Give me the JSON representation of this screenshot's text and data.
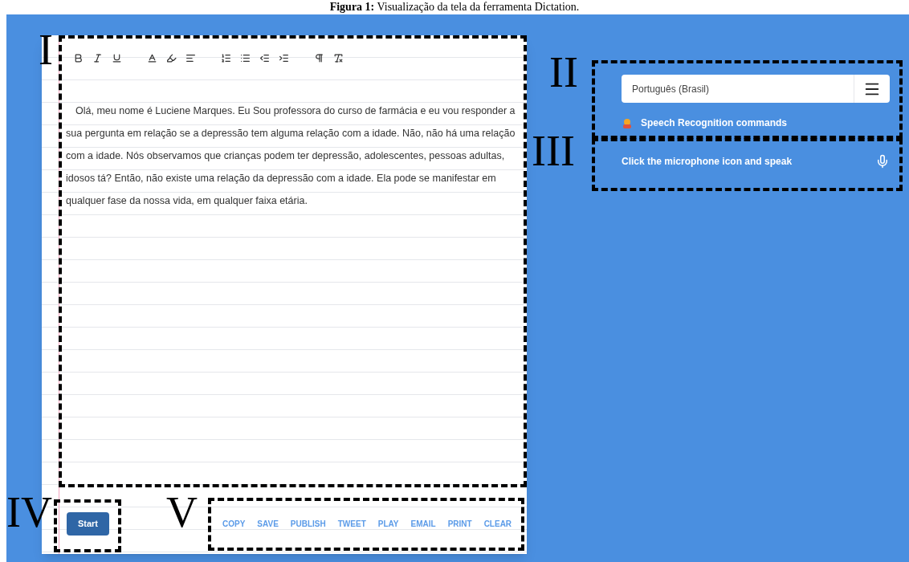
{
  "caption": "**Figura 1:** Visualização da tela da ferramenta Dictation.",
  "annotations": [
    {
      "label": "I"
    },
    {
      "label": "II"
    },
    {
      "label": "III"
    },
    {
      "label": "IV"
    },
    {
      "label": "V"
    }
  ],
  "editor": {
    "text": "Olá, meu nome é Luciene Marques. Eu Sou professora do curso de farmácia e eu vou responder a sua pergunta em relação se a depressão tem alguma relação com a idade. Não, não há uma relação com a idade. Nós observamos que crianças podem ter depressão, adolescentes, pessoas adultas, idosos tá? Então, não existe uma relação da depressão com a idade. Ela pode se manifestar em qualquer fase da nossa vida, em qualquer faixa etária."
  },
  "language_select": {
    "value": "Português (Brasil)"
  },
  "commands_link": "Speech Recognition commands",
  "mic_prompt": "Click the microphone icon and speak",
  "start_button": "Start",
  "actions": [
    "COPY",
    "SAVE",
    "PUBLISH",
    "TWEET",
    "PLAY",
    "EMAIL",
    "PRINT",
    "CLEAR"
  ]
}
